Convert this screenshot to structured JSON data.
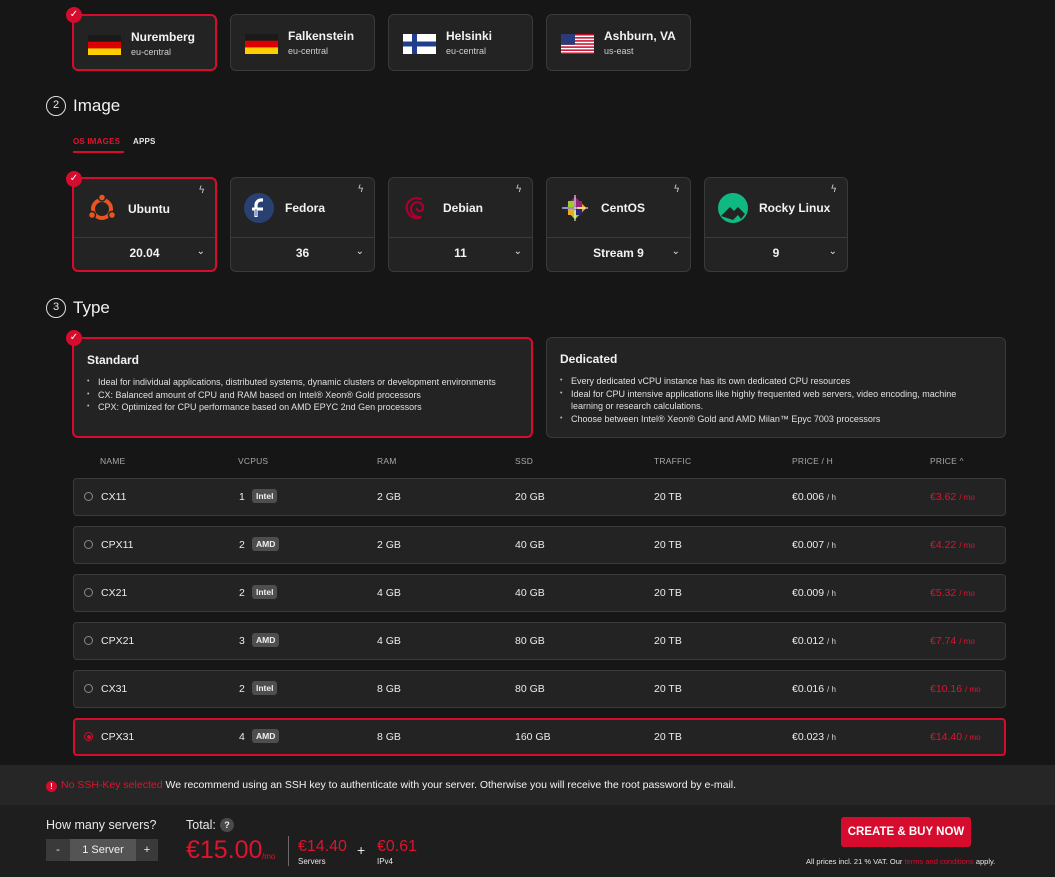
{
  "locations": [
    {
      "name": "Nuremberg",
      "zone": "eu-central",
      "flag": "germany-flag",
      "selected": true
    },
    {
      "name": "Falkenstein",
      "zone": "eu-central",
      "flag": "germany-flag",
      "selected": false
    },
    {
      "name": "Helsinki",
      "zone": "eu-central",
      "flag": "finland-flag",
      "selected": false
    },
    {
      "name": "Ashburn, VA",
      "zone": "us-east",
      "flag": "usa-flag",
      "selected": false
    }
  ],
  "image_section": {
    "step": "2",
    "title": "Image",
    "tabs": [
      {
        "label": "OS IMAGES",
        "active": true
      },
      {
        "label": "APPS",
        "active": false
      }
    ],
    "images": [
      {
        "name": "Ubuntu",
        "version": "20.04",
        "icon": "ubuntu-logo-icon",
        "selected": true
      },
      {
        "name": "Fedora",
        "version": "36",
        "icon": "fedora-logo-icon",
        "selected": false
      },
      {
        "name": "Debian",
        "version": "11",
        "icon": "debian-logo-icon",
        "selected": false
      },
      {
        "name": "CentOS",
        "version": "Stream 9",
        "icon": "centos-logo-icon",
        "selected": false
      },
      {
        "name": "Rocky Linux",
        "version": "9",
        "icon": "rocky-linux-logo-icon",
        "selected": false
      }
    ]
  },
  "type_section": {
    "step": "3",
    "title": "Type",
    "types": [
      {
        "title": "Standard",
        "selected": true,
        "bullets": [
          "Ideal for individual applications, distributed systems, dynamic clusters or development environments",
          "CX: Balanced amount of CPU and RAM based on Intel® Xeon® Gold processors",
          "CPX: Optimized for CPU performance based on AMD EPYC 2nd Gen processors"
        ]
      },
      {
        "title": "Dedicated",
        "selected": false,
        "bullets": [
          "Every dedicated vCPU instance has its own dedicated CPU resources",
          "Ideal for CPU intensive applications like highly frequented web servers, video encoding, machine learning or research calculations.",
          "Choose between Intel® Xeon® Gold and AMD Milan™ Epyc 7003 processors"
        ]
      }
    ]
  },
  "table": {
    "headers": [
      "NAME",
      "VCPUS",
      "RAM",
      "SSD",
      "TRAFFIC",
      "PRICE / H",
      "PRICE ^"
    ],
    "rows": [
      {
        "name": "CX11",
        "vcpus": "1",
        "cpu": "Intel",
        "ram": "2 GB",
        "ssd": "20 GB",
        "traffic": "20 TB",
        "price_h": "€0.006",
        "price_h_unit": "/ h",
        "price": "€3.62",
        "price_unit": "/ mo",
        "selected": false
      },
      {
        "name": "CPX11",
        "vcpus": "2",
        "cpu": "AMD",
        "ram": "2 GB",
        "ssd": "40 GB",
        "traffic": "20 TB",
        "price_h": "€0.007",
        "price_h_unit": "/ h",
        "price": "€4.22",
        "price_unit": "/ mo",
        "selected": false
      },
      {
        "name": "CX21",
        "vcpus": "2",
        "cpu": "Intel",
        "ram": "4 GB",
        "ssd": "40 GB",
        "traffic": "20 TB",
        "price_h": "€0.009",
        "price_h_unit": "/ h",
        "price": "€5.32",
        "price_unit": "/ mo",
        "selected": false
      },
      {
        "name": "CPX21",
        "vcpus": "3",
        "cpu": "AMD",
        "ram": "4 GB",
        "ssd": "80 GB",
        "traffic": "20 TB",
        "price_h": "€0.012",
        "price_h_unit": "/ h",
        "price": "€7.74",
        "price_unit": "/ mo",
        "selected": false
      },
      {
        "name": "CX31",
        "vcpus": "2",
        "cpu": "Intel",
        "ram": "8 GB",
        "ssd": "80 GB",
        "traffic": "20 TB",
        "price_h": "€0.016",
        "price_h_unit": "/ h",
        "price": "€10.16",
        "price_unit": "/ mo",
        "selected": false
      },
      {
        "name": "CPX31",
        "vcpus": "4",
        "cpu": "AMD",
        "ram": "8 GB",
        "ssd": "160 GB",
        "traffic": "20 TB",
        "price_h": "€0.023",
        "price_h_unit": "/ h",
        "price": "€14.40",
        "price_unit": "/ mo",
        "selected": true
      }
    ]
  },
  "warning": {
    "icon": "exclamation-icon",
    "highlight": "No SSH-Key selected",
    "text": "We recommend using an SSH key to authenticate with your server. Otherwise you will receive the root password by e-mail."
  },
  "footer": {
    "servers_label": "How many servers?",
    "minus": "-",
    "count": "1 Server",
    "plus": "+",
    "total_label": "Total:",
    "help": "?",
    "total": "€15.00",
    "total_unit": "/mo",
    "servers_price": "€14.40",
    "servers_price_label": "Servers",
    "plus_sign": "+",
    "ipv4_price": "€0.61",
    "ipv4_label": "IPv4",
    "buy_label": "CREATE & BUY NOW",
    "vat_prefix": "All prices incl. 21 % VAT. Our",
    "vat_link": "terms and conditions",
    "vat_suffix": "apply."
  },
  "colors": {
    "accent": "#d50c2d",
    "background": "#161616",
    "card": "#232323"
  }
}
